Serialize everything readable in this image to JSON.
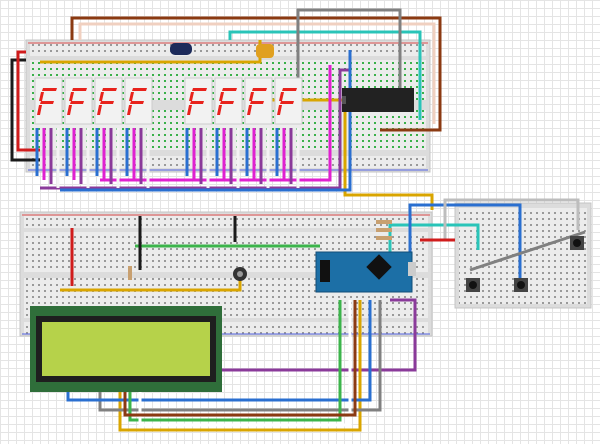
{
  "canvas": {
    "background": "#ffffff",
    "grid_color": "#e4e4e4"
  },
  "components": {
    "seven_segment_displays": {
      "count": 8,
      "lit_segment_color": "#e8221c"
    },
    "driver_chip": {
      "color": "#222222"
    },
    "microcontroller": {
      "board": "nano",
      "color": "#1c6fa6"
    },
    "lcd": {
      "pcb_color": "#2f6e3a",
      "screen_color": "#b6d24a"
    },
    "pushbuttons": {
      "count": 3
    },
    "potentiometer": {
      "count": 1
    },
    "capacitors": {
      "count": 2
    }
  },
  "wire_colors": {
    "red": "#d01c1c",
    "black": "#1a1a1a",
    "blue": "#2a6fd0",
    "magenta": "#e020d0",
    "purple": "#8a3a9a",
    "yellow": "#d9a500",
    "cyan": "#29c4b8",
    "gray": "#808080",
    "brown": "#8b3a12",
    "green": "#3cb44b",
    "white": "#f4f4f4"
  }
}
